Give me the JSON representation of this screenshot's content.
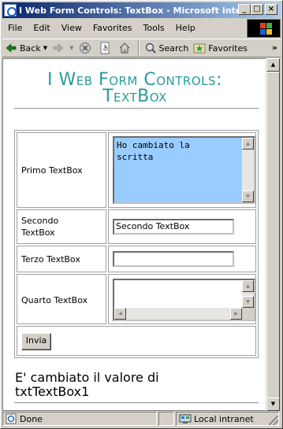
{
  "window": {
    "title": "I Web Form Controls: TextBox - Microsoft Internet Explorer",
    "min_label": "_",
    "max_label": "□",
    "close_label": "×"
  },
  "menu": {
    "items": [
      {
        "label": "File"
      },
      {
        "label": "Edit"
      },
      {
        "label": "View"
      },
      {
        "label": "Favorites"
      },
      {
        "label": "Tools"
      },
      {
        "label": "Help"
      }
    ]
  },
  "toolbar": {
    "back_label": "Back",
    "search_label": "Search",
    "favorites_label": "Favorites",
    "more_glyph": "»"
  },
  "page": {
    "title_line1": "I Web Form Controls:",
    "title_line2": "TextBox",
    "rows": [
      {
        "label": "Primo TextBox",
        "value": "Ho cambiato la\nscritta",
        "bg": "#99ccff"
      },
      {
        "label_line1": "Secondo",
        "label_line2": "TextBox",
        "value": "Secondo TextBox"
      },
      {
        "label": "Terzo TextBox",
        "value": ""
      },
      {
        "label": "Quarto TextBox",
        "value": ""
      }
    ],
    "submit_label": "Invia",
    "message_line1": "E' cambiato il valore di",
    "message_line2": "txtTextBox1"
  },
  "status": {
    "text": "Done",
    "zone": "Local intranet"
  },
  "colors": {
    "title_teal": "#2a9a9a",
    "titlebar_start": "#0a246a",
    "titlebar_end": "#a6caf0",
    "textarea_highlight": "#99ccff"
  }
}
